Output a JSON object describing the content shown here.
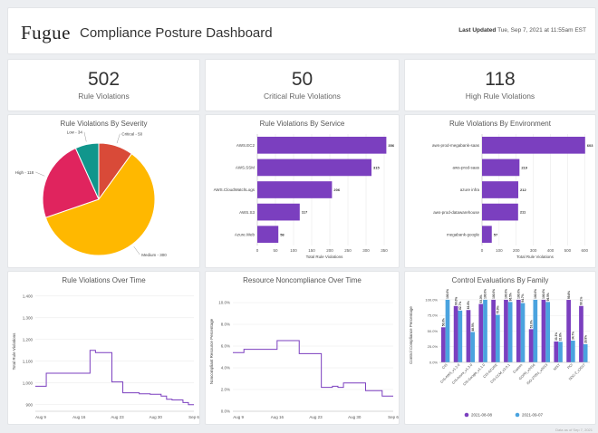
{
  "header": {
    "logo": "Fugue",
    "title": "Compliance Posture Dashboard",
    "last_updated_label": "Last Updated",
    "last_updated_value": "Tue, Sep 7, 2021 at 11:55am EST"
  },
  "kpis": [
    {
      "value": "502",
      "label": "Rule Violations"
    },
    {
      "value": "50",
      "label": "Critical Rule Violations"
    },
    {
      "value": "118",
      "label": "High Rule Violations"
    }
  ],
  "colors": {
    "purple": "#7b3fbf",
    "blue": "#4aa3df",
    "critical": "#d94a38",
    "high": "#e0245e",
    "medium": "#ffb800",
    "low": "#11968c"
  },
  "chart_data": [
    {
      "type": "pie",
      "title": "Rule Violations By Severity",
      "slices": [
        {
          "label": "Critical",
          "value": 50,
          "display": "Critical - 50",
          "color": "#d94a38"
        },
        {
          "label": "Medium",
          "value": 300,
          "display": "Medium - 300",
          "color": "#ffb800"
        },
        {
          "label": "High",
          "value": 118,
          "display": "High - 118",
          "color": "#e0245e"
        },
        {
          "label": "Low",
          "value": 34,
          "display": "Low - 34",
          "color": "#11968c"
        }
      ]
    },
    {
      "type": "bar",
      "orientation": "horizontal",
      "title": "Rule Violations By Service",
      "categories": [
        "AWS.EC2",
        "AWS.SSM",
        "AWS.CloudWatchLogs",
        "AWS.S3",
        "Azure.Web"
      ],
      "values": [
        356,
        315,
        206,
        117,
        58
      ],
      "xlabel": "Total Rule Violations",
      "xticks": [
        0,
        50,
        100,
        150,
        200,
        250,
        300,
        350
      ],
      "xlim": [
        0,
        370
      ],
      "color": "#7b3fbf"
    },
    {
      "type": "bar",
      "orientation": "horizontal",
      "title": "Rule Violations By Environment",
      "categories": [
        "aws-prod-megabank-saas",
        "aws-prod-saas",
        "azure infra",
        "aws-prod-datawarehouse",
        "megabank-google"
      ],
      "values": [
        603,
        219,
        212,
        211,
        57
      ],
      "xlabel": "Total Rule Violations",
      "xticks": [
        0,
        100,
        200,
        300,
        400,
        500,
        600
      ],
      "xlim": [
        0,
        620
      ],
      "color": "#7b3fbf"
    },
    {
      "type": "line",
      "title": "Rule Violations Over Time",
      "ylabel": "Total Rule Violations",
      "x": [
        "2021-08-08",
        "2021-08-09",
        "2021-08-10",
        "2021-08-11",
        "2021-08-12",
        "2021-08-13",
        "2021-08-14",
        "2021-08-15",
        "2021-08-16",
        "2021-08-17",
        "2021-08-18",
        "2021-08-19",
        "2021-08-20",
        "2021-08-21",
        "2021-08-22",
        "2021-08-23",
        "2021-08-24",
        "2021-08-25",
        "2021-08-26",
        "2021-08-27",
        "2021-08-28",
        "2021-08-29",
        "2021-08-30",
        "2021-08-31",
        "2021-09-01",
        "2021-09-02",
        "2021-09-03",
        "2021-09-04",
        "2021-09-05",
        "2021-09-06"
      ],
      "y": [
        985,
        985,
        1045,
        1045,
        1045,
        1045,
        1045,
        1045,
        1045,
        1045,
        1150,
        1140,
        1140,
        1140,
        1005,
        1005,
        955,
        955,
        955,
        950,
        950,
        948,
        948,
        940,
        925,
        922,
        922,
        910,
        900,
        900
      ],
      "xticks": [
        "Aug 9",
        "Aug 16",
        "Aug 23",
        "Aug 30",
        "Sep 6"
      ],
      "xtick_dates": [
        "2021-08-09",
        "2021-08-16",
        "2021-08-23",
        "2021-08-30",
        "2021-09-06"
      ],
      "ylim": [
        870,
        1420
      ],
      "yticks": [
        "900",
        "1,000",
        "1,100",
        "1,200",
        "1,300",
        "1,400"
      ],
      "ytick_values": [
        900,
        1000,
        1100,
        1200,
        1300,
        1400
      ],
      "color": "#7b3fbf"
    },
    {
      "type": "line",
      "title": "Resource Noncompliance Over Time",
      "ylabel": "Noncompliant Resource Percentage",
      "x": [
        "2021-08-08",
        "2021-08-09",
        "2021-08-10",
        "2021-08-11",
        "2021-08-12",
        "2021-08-13",
        "2021-08-14",
        "2021-08-15",
        "2021-08-16",
        "2021-08-17",
        "2021-08-18",
        "2021-08-19",
        "2021-08-20",
        "2021-08-21",
        "2021-08-22",
        "2021-08-23",
        "2021-08-24",
        "2021-08-25",
        "2021-08-26",
        "2021-08-27",
        "2021-08-28",
        "2021-08-29",
        "2021-08-30",
        "2021-08-31",
        "2021-09-01",
        "2021-09-02",
        "2021-09-03",
        "2021-09-04",
        "2021-09-05",
        "2021-09-06"
      ],
      "y": [
        5.4,
        5.4,
        5.7,
        5.7,
        5.7,
        5.7,
        5.7,
        5.7,
        6.5,
        6.5,
        6.5,
        6.5,
        5.3,
        5.3,
        5.3,
        5.3,
        2.2,
        2.2,
        2.3,
        2.2,
        2.6,
        2.6,
        2.6,
        2.6,
        1.9,
        1.9,
        1.9,
        1.4,
        1.4,
        1.4
      ],
      "xticks": [
        "Aug 9",
        "Aug 16",
        "Aug 23",
        "Aug 30",
        "Sep 6"
      ],
      "xtick_dates": [
        "2021-08-09",
        "2021-08-16",
        "2021-08-23",
        "2021-08-30",
        "2021-09-06"
      ],
      "ylim": [
        0,
        11
      ],
      "yticks": [
        "0.0%",
        "2.0%",
        "4.0%",
        "6.0%",
        "8.0%",
        "10.0%"
      ],
      "ytick_values": [
        0,
        2,
        4,
        6,
        8,
        10
      ],
      "color": "#7b3fbf"
    },
    {
      "type": "bar",
      "title": "Control Evaluations By Family",
      "ylabel": "Control Compliance Percentage",
      "categories": [
        "CIS",
        "CIS-AWS_v1.2.0",
        "CIS-Azure_v1.3.0",
        "CIS-Google_v1.1.0",
        "CIS-AZURE",
        "CIS-CCM_v3.0.1",
        "Custom",
        "GDPR_v2016",
        "ISO-27001_v2013",
        "NIST",
        "PCI",
        "SOC-2_v2017"
      ],
      "series": [
        {
          "name": "2021-08-08",
          "color": "#7b3fbf",
          "values": [
            56.0,
            90.0,
            83.6,
            93.3,
            100.0,
            100.0,
            100.0,
            53.0,
            100.0,
            33.3,
            99.8,
            90.1
          ]
        },
        {
          "name": "2021-09-07",
          "color": "#4aa3df",
          "values": [
            100.0,
            82.7,
            48.5,
            100.0,
            75.9,
            96.5,
            94.7,
            100.0,
            96.5,
            32.8,
            34.7,
            28.9
          ]
        }
      ],
      "data_labels": [
        [
          "56.0%",
          "90.0%",
          "83.6%",
          "93.3%",
          "100.0%",
          "100.0%",
          "100.0%",
          "53.0%",
          "100.0%",
          "33.3%",
          "99.8%",
          "90.1%"
        ],
        [
          "100.0%",
          "82.7%",
          "48.5%",
          "100.0%",
          "75.9%",
          "96.5%",
          "94.7%",
          "100.0%",
          "96.5%",
          "32.8%",
          "34.7%",
          "28.9%"
        ]
      ],
      "ylim": [
        0,
        110
      ],
      "yticks": [
        "0.0%",
        "25.0%",
        "50.0%",
        "75.0%",
        "100.0%"
      ],
      "ytick_values": [
        0,
        25,
        50,
        75,
        100
      ],
      "legend_position": "bottom"
    }
  ],
  "footnote": "Data as of Sep 7, 2021"
}
